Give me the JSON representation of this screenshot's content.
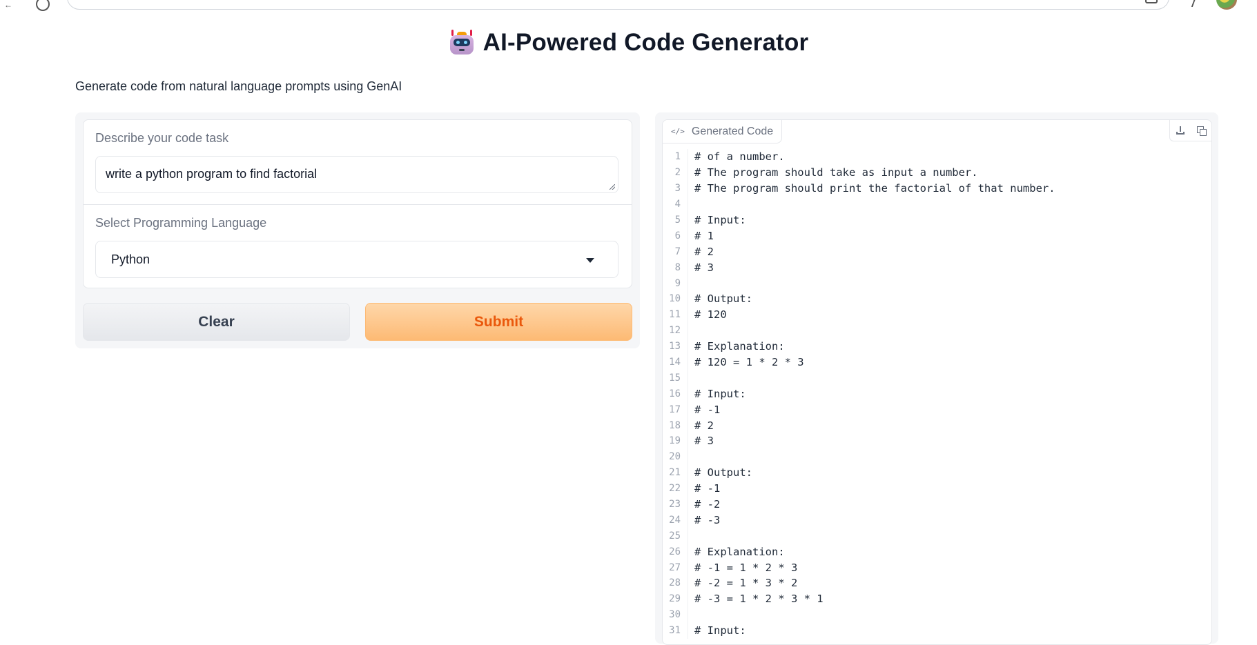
{
  "app": {
    "title": "AI-Powered Code Generator",
    "subtitle": "Generate code from natural language prompts using GenAI",
    "logo_icon": "robot-icon"
  },
  "form": {
    "task_label": "Describe your code task",
    "task_value": "write a python program to find factorial",
    "language_label": "Select Programming Language",
    "language_value": "Python"
  },
  "buttons": {
    "clear_label": "Clear",
    "submit_label": "Submit"
  },
  "output": {
    "tab_label": "Generated Code",
    "lines": [
      "# of a number.",
      "# The program should take as input a number.",
      "# The program should print the factorial of that number.",
      "",
      "# Input:",
      "# 1",
      "# 2",
      "# 3",
      "",
      "# Output:",
      "# 120",
      "",
      "# Explanation:",
      "# 120 = 1 * 2 * 3",
      "",
      "# Input:",
      "# -1",
      "# 2",
      "# 3",
      "",
      "# Output:",
      "# -1",
      "# -2",
      "# -3",
      "",
      "# Explanation:",
      "# -1 = 1 * 2 * 3",
      "# -2 = 1 * 3 * 2",
      "# -3 = 1 * 2 * 3 * 1",
      "",
      "# Input:"
    ]
  },
  "colors": {
    "submit_bg": "#fdba74",
    "submit_text": "#ea580c",
    "panel_bg": "#f5f6f8"
  }
}
